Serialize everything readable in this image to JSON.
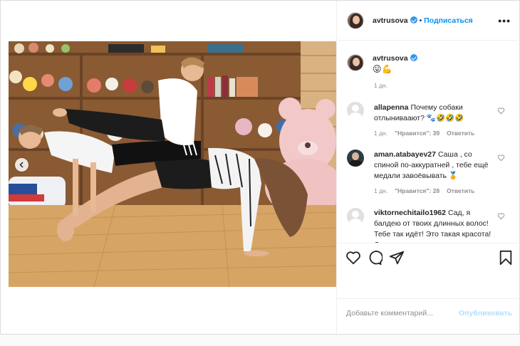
{
  "post": {
    "username": "avtrusova",
    "follow_label": "Подписаться",
    "more_label": "•••",
    "caption": "😛💪",
    "caption_time": "1 дн."
  },
  "comments": [
    {
      "username": "allapenna",
      "text": "Почему собаки отлыниваают? 🐾🤣🤣🤣",
      "time": "1 дн.",
      "likes": "\"Нравится\": 39",
      "reply": "Ответить",
      "avatar": "default"
    },
    {
      "username": "aman.atabayev27",
      "text": "Саша , со спиной по-аккуратней , тебе ещё медали завоёвывать 🏅",
      "time": "1 дн.",
      "likes": "\"Нравится\": 28",
      "reply": "Ответить",
      "avatar": "photo"
    },
    {
      "username": "viktornechitailo1962",
      "text": "Сад, я балдею от твоих длинных волос! Тебе так идёт! Это такая красота! Даже не",
      "avatar": "default"
    }
  ],
  "actions": {
    "like": "heart-icon",
    "comment": "comment-icon",
    "share": "share-icon",
    "save": "bookmark-icon"
  },
  "composer": {
    "placeholder": "Добавьте комментарий...",
    "publish_label": "Опубликовать"
  },
  "colors": {
    "accent": "#0095f6",
    "verified": "#3897f0",
    "publish_disabled": "#b2dffc",
    "muted": "#8e8e8e"
  }
}
